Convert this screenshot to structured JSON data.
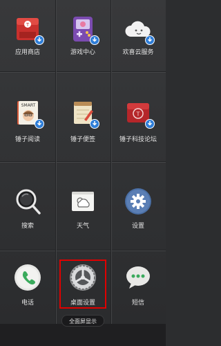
{
  "apps": [
    {
      "label": "应用商店",
      "icon": "app-store-icon"
    },
    {
      "label": "游戏中心",
      "icon": "game-center-icon"
    },
    {
      "label": "欢喜云服务",
      "icon": "cloud-service-icon"
    },
    {
      "label": "锤子阅读",
      "icon": "reading-icon",
      "badge_text": "SMART"
    },
    {
      "label": "锤子便签",
      "icon": "notes-icon"
    },
    {
      "label": "锤子科技论坛",
      "icon": "forum-icon"
    },
    {
      "label": "搜索",
      "icon": "search-icon"
    },
    {
      "label": "天气",
      "icon": "weather-icon"
    },
    {
      "label": "设置",
      "icon": "settings-icon"
    },
    {
      "label": "电话",
      "icon": "phone-icon"
    },
    {
      "label": "桌面设置",
      "icon": "desktop-settings-icon"
    },
    {
      "label": "短信",
      "icon": "messages-icon"
    }
  ],
  "fullscreen_button": "全面屏显示",
  "colors": {
    "badge": "#2f7ed8",
    "highlight": "#e00000",
    "settings_blue": "#4a6fa5"
  }
}
